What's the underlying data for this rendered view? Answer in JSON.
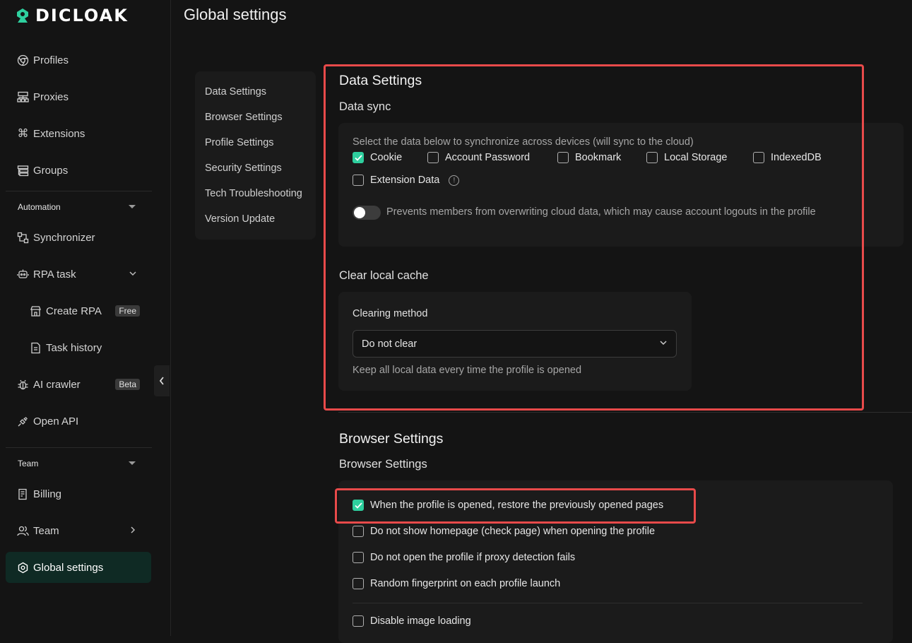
{
  "app": {
    "logo_text": "DICLOAK",
    "page_title": "Global settings"
  },
  "sidebar": {
    "items": [
      {
        "label": "Profiles",
        "icon": "chrome-icon"
      },
      {
        "label": "Proxies",
        "icon": "network-icon"
      },
      {
        "label": "Extensions",
        "icon": "command-icon"
      },
      {
        "label": "Groups",
        "icon": "groups-icon"
      }
    ],
    "automation_label": "Automation",
    "automation_items": [
      {
        "label": "Synchronizer",
        "icon": "sync-icon"
      },
      {
        "label": "RPA task",
        "icon": "robot-icon"
      },
      {
        "label": "Create RPA",
        "icon": "store-icon",
        "badge": "Free"
      },
      {
        "label": "Task history",
        "icon": "document-icon"
      },
      {
        "label": "AI crawler",
        "icon": "bug-icon",
        "badge": "Beta"
      },
      {
        "label": "Open API",
        "icon": "plug-icon"
      }
    ],
    "team_label": "Team",
    "team_items": [
      {
        "label": "Billing",
        "icon": "receipt-icon"
      },
      {
        "label": "Team",
        "icon": "users-icon"
      },
      {
        "label": "Global settings",
        "icon": "settings-hex-icon"
      }
    ]
  },
  "subnav": [
    "Data Settings",
    "Browser Settings",
    "Profile Settings",
    "Security Settings",
    "Tech Troubleshooting",
    "Version Update"
  ],
  "data_settings": {
    "title": "Data Settings",
    "sync_title": "Data sync",
    "sync_desc": "Select the data below to synchronize across devices (will sync to the cloud)",
    "options": [
      {
        "label": "Cookie",
        "checked": true
      },
      {
        "label": "Account Password",
        "checked": false
      },
      {
        "label": "Bookmark",
        "checked": false
      },
      {
        "label": "Local Storage",
        "checked": false
      },
      {
        "label": "IndexedDB",
        "checked": false
      },
      {
        "label": "Extension Data",
        "checked": false
      }
    ],
    "toggle_label": "Prevents members from overwriting cloud data, which may cause account logouts in the profile",
    "toggle_on": false,
    "cache_title": "Clear local cache",
    "clearing_method_label": "Clearing method",
    "clearing_method_value": "Do not clear",
    "clearing_hint": "Keep all local data every time the profile is opened"
  },
  "browser_settings": {
    "title": "Browser Settings",
    "sub_title": "Browser Settings",
    "options": [
      {
        "label": "When the profile is opened, restore the previously opened pages",
        "checked": true
      },
      {
        "label": "Do not show homepage (check page) when opening the profile",
        "checked": false
      },
      {
        "label": "Do not open the profile if proxy detection fails",
        "checked": false
      },
      {
        "label": "Random fingerprint on each profile launch",
        "checked": false
      },
      {
        "label": "Disable image loading",
        "checked": false
      }
    ]
  },
  "colors": {
    "accent": "#2ecf9e",
    "highlight": "#e84a4a",
    "active_bg": "#0f2a24"
  }
}
